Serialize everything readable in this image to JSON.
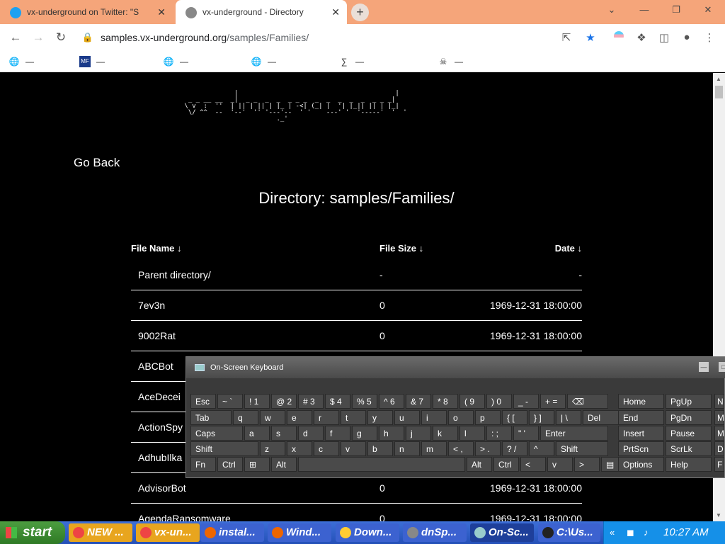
{
  "browser": {
    "tabs": [
      {
        "title": "vx-underground on Twitter: \"S",
        "close": "✕"
      },
      {
        "title": "vx-underground - Directory",
        "close": "✕"
      }
    ],
    "new_tab": "+",
    "window_buttons": {
      "minimize": "⌄",
      "min": "—",
      "restore": "❐",
      "close": "✕"
    },
    "url_host": "samples.vx-underground.org",
    "url_path": "/samples/Families/",
    "bookmarks": [
      {
        "label": "—",
        "icon": "globe"
      },
      {
        "label": "—",
        "icon": "mf"
      },
      {
        "label": "—",
        "icon": "globe"
      },
      {
        "label": "—",
        "icon": "globe"
      },
      {
        "label": "—",
        "icon": "sigma"
      },
      {
        "label": "—",
        "icon": "skull"
      }
    ]
  },
  "page": {
    "logo_text": "              |                                         |\n  _ _ __ __  _|  _ _  _  _  _ _ _  _  _  _  _  _  _ _ _|\n \\ v  :  ''  | || | || | |_ | -<| (_| |  '| |_|| || | |_|\n  \\/ ^^  --  '--'  '' '---'--  ' '    ---' '  '-----'  '  '\n                         ._'",
    "go_back": "Go Back",
    "directory_title": "Directory: samples/Families/",
    "columns": {
      "name": "File Name  ↓",
      "size": "File Size  ↓",
      "date": "Date  ↓"
    },
    "rows": [
      {
        "name": "Parent directory/",
        "size": "-",
        "date": "-"
      },
      {
        "name": "7ev3n",
        "size": "0",
        "date": "1969-12-31 18:00:00"
      },
      {
        "name": "9002Rat",
        "size": "0",
        "date": "1969-12-31 18:00:00"
      },
      {
        "name": "ABCBot",
        "size": "",
        "date": ""
      },
      {
        "name": "AceDecei",
        "size": "",
        "date": ""
      },
      {
        "name": "ActionSpy",
        "size": "",
        "date": ""
      },
      {
        "name": "AdhubIlka",
        "size": "",
        "date": ""
      },
      {
        "name": "AdvisorBot",
        "size": "0",
        "date": "1969-12-31 18:00:00"
      },
      {
        "name": "AgendaRansomware",
        "size": "0",
        "date": "1969-12-31 18:00:00"
      }
    ]
  },
  "osk": {
    "title": "On-Screen Keyboard",
    "rows": [
      [
        "Esc",
        "~ `",
        "! 1",
        "@ 2",
        "# 3",
        "$ 4",
        "% 5",
        "^ 6",
        "& 7",
        "* 8",
        "( 9",
        ") 0",
        "_ -",
        "+ =",
        "⌫"
      ],
      [
        "Tab",
        "q",
        "w",
        "e",
        "r",
        "t",
        "y",
        "u",
        "i",
        "o",
        "p",
        "{ [",
        "} ]",
        "| \\",
        "Del"
      ],
      [
        "Caps",
        "a",
        "s",
        "d",
        "f",
        "g",
        "h",
        "j",
        "k",
        "l",
        ": ;",
        "\" '",
        "Enter"
      ],
      [
        "Shift",
        "z",
        "x",
        "c",
        "v",
        "b",
        "n",
        "m",
        "< ,",
        "> .",
        "? /",
        "^",
        "Shift"
      ],
      [
        "Fn",
        "Ctrl",
        "⊞",
        "Alt",
        "",
        "Alt",
        "Ctrl",
        "<",
        "v",
        ">",
        "▤"
      ]
    ],
    "nav_keys": [
      [
        "Home",
        "PgUp"
      ],
      [
        "End",
        "PgDn"
      ],
      [
        "Insert",
        "Pause"
      ],
      [
        "PrtScn",
        "ScrLk"
      ],
      [
        "Options",
        "Help"
      ]
    ],
    "edge_keys": [
      "N",
      "M",
      "M",
      "D",
      "F"
    ]
  },
  "taskbar": {
    "start": "start",
    "items": [
      {
        "label": "NEW ...",
        "color": "#e8a51e"
      },
      {
        "label": "vx-un...",
        "color": "#e8a51e"
      },
      {
        "label": "instal...",
        "color": "#3c62d0"
      },
      {
        "label": "Wind...",
        "color": "#3c62d0"
      },
      {
        "label": "Down...",
        "color": "#3c62d0"
      },
      {
        "label": "dnSp...",
        "color": "#3c62d0"
      },
      {
        "label": "On-Sc...",
        "color": "#1e3f9a"
      },
      {
        "label": "C:\\Us...",
        "color": "#3c62d0"
      }
    ],
    "tray_expand": "«",
    "time": "10:27 AM"
  },
  "colors": {
    "tabbar": "#f5a57a",
    "page_bg": "#000000",
    "taskbar": "#2450b8",
    "start": "#3a8c2f"
  }
}
